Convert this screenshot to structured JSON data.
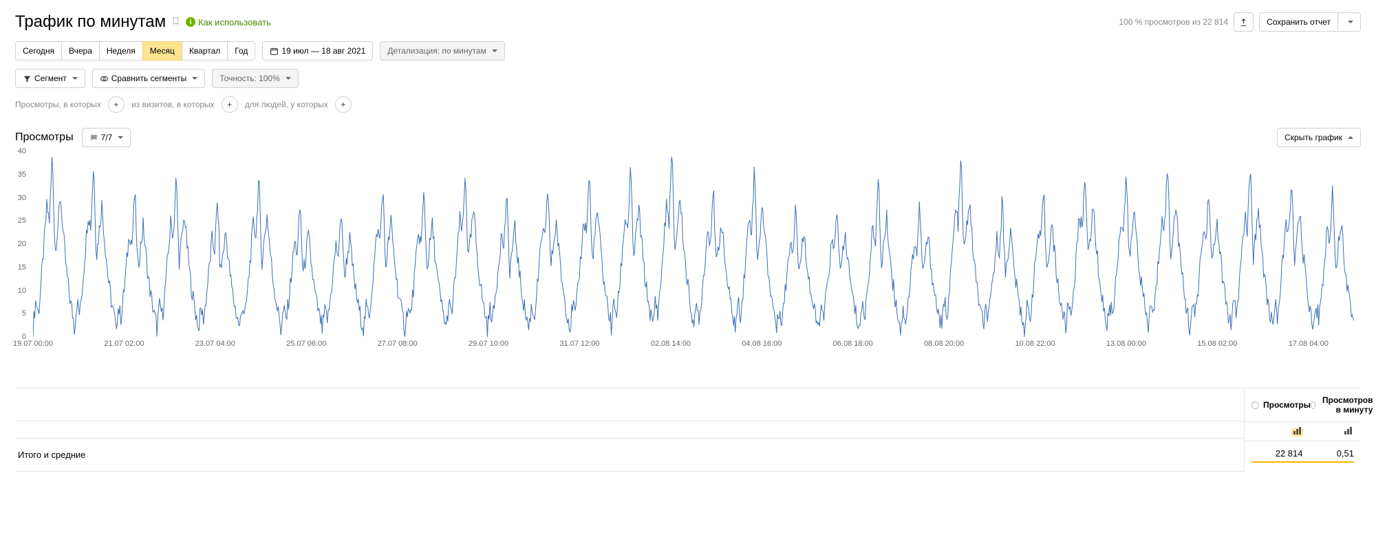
{
  "header": {
    "title": "Трафик по минутам",
    "howto": "Как использовать",
    "views_info": "100 % просмотров из 22 814",
    "save_report": "Сохранить отчет"
  },
  "periods": {
    "today": "Сегодня",
    "yesterday": "Вчера",
    "week": "Неделя",
    "month": "Месяц",
    "quarter": "Квартал",
    "year": "Год",
    "range": "19 июл — 18 авг 2021",
    "active": "month"
  },
  "detail": {
    "label": "Детализация: по минутам"
  },
  "segment": {
    "label": "Сегмент",
    "compare": "Сравнить сегменты",
    "accuracy": "Точность: 100%"
  },
  "filters": {
    "views_where": "Просмотры, в которых",
    "from_visits": "из визитов, в которых",
    "for_people": "для людей, у которых"
  },
  "views": {
    "title": "Просмотры",
    "counter": "7/7",
    "hide": "Скрыть график"
  },
  "summary": {
    "col1": "Просмотры",
    "col2": "Просмотров в минуту",
    "total_label": "Итого и средние",
    "total_views": "22 814",
    "per_minute": "0,51"
  },
  "chart_data": {
    "type": "line",
    "title": "",
    "xlabel": "",
    "ylabel": "",
    "ylim": [
      0,
      40
    ],
    "y_ticks": [
      0,
      5,
      10,
      15,
      20,
      25,
      30,
      35,
      40
    ],
    "x_ticks": [
      "19.07 00:00",
      "21.07 02:00",
      "23.07 04:00",
      "25.07 06:00",
      "27.07 08:00",
      "29.07 10:00",
      "31.07 12:00",
      "02.08 14:00",
      "04.08 16:00",
      "06.08 18:00",
      "08.08 20:00",
      "10.08 22:00",
      "13.08 00:00",
      "15.08 02:00",
      "17.08 04:00"
    ],
    "series": [
      {
        "name": "Просмотры",
        "color": "#3b6fb6",
        "day_samples": [
          2,
          8,
          5,
          12,
          20,
          28,
          25,
          40,
          18,
          24,
          30,
          22,
          15,
          10,
          6,
          3
        ],
        "daily_peaks": [
          40,
          38,
          32,
          35,
          30,
          35,
          29,
          28,
          33,
          32,
          36,
          31,
          33,
          36,
          37,
          40,
          33,
          37,
          30,
          29,
          34,
          29,
          39,
          30,
          32,
          37,
          36,
          38,
          33,
          37,
          35,
          33
        ]
      }
    ]
  }
}
